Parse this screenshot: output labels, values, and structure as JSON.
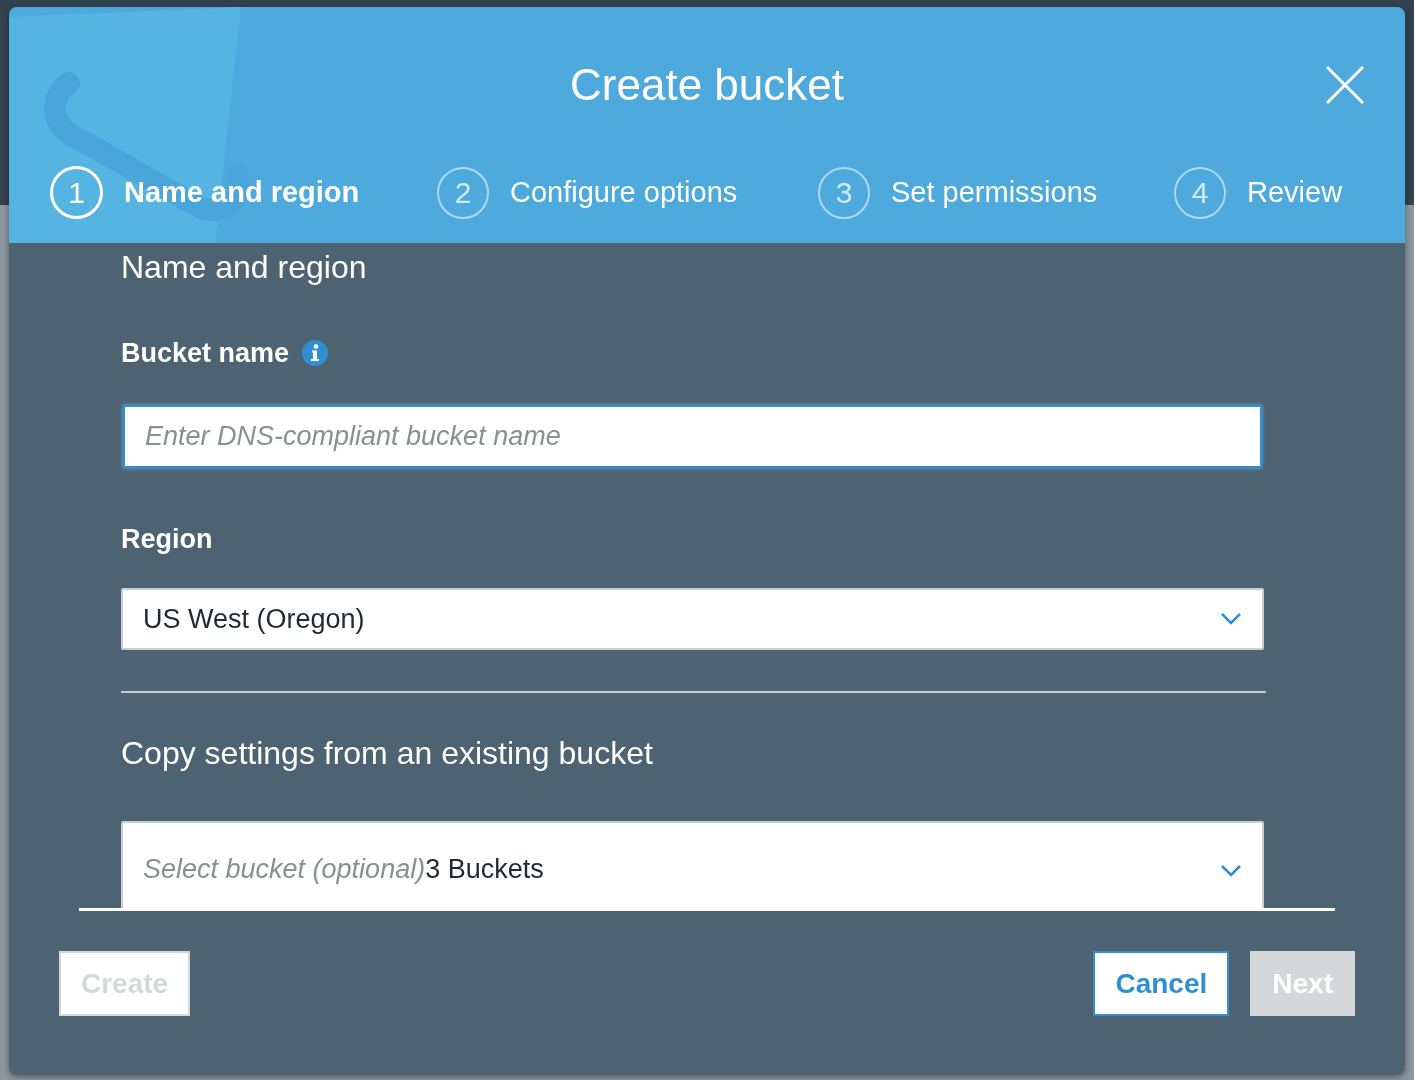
{
  "dialog": {
    "title": "Create bucket",
    "steps": [
      {
        "number": "1",
        "label": "Name and region",
        "selected": true
      },
      {
        "number": "2",
        "label": "Configure options",
        "selected": false
      },
      {
        "number": "3",
        "label": "Set permissions",
        "selected": false
      },
      {
        "number": "4",
        "label": "Review",
        "selected": false
      }
    ],
    "section_title": "Name and region",
    "fields": [
      {
        "kind": "text",
        "label": "Bucket name",
        "info": true,
        "placeholder": "Enter DNS-compliant bucket name"
      },
      {
        "kind": "select",
        "label": "Region",
        "value": "US West (Oregon)"
      }
    ],
    "copy_settings": {
      "title": "Copy settings from an existing bucket",
      "placeholder": "Select bucket (optional)",
      "count": "3 Buckets"
    },
    "footer": {
      "left_buttons": [
        {
          "label": "Create",
          "disabled": true
        }
      ],
      "right_buttons": [
        {
          "label": "Cancel",
          "kind": "secondary",
          "disabled": false
        },
        {
          "label": "Next",
          "kind": "primary",
          "disabled": true
        }
      ]
    }
  }
}
